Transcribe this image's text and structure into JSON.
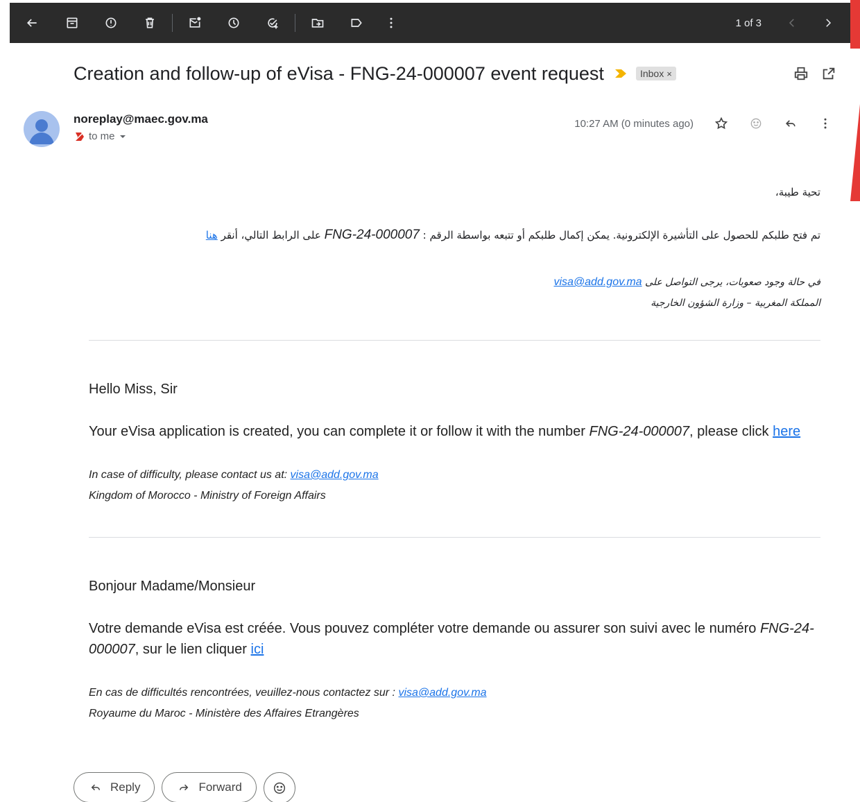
{
  "toolbar": {
    "icons": [
      "back-arrow-icon",
      "archive-icon",
      "report-spam-icon",
      "delete-icon",
      "mark-unread-icon",
      "snooze-icon",
      "add-task-icon",
      "move-to-icon",
      "label-icon",
      "more-vert-icon"
    ],
    "pager_text": "1 of 3"
  },
  "email": {
    "subject": "Creation and follow-up of eVisa - FNG-24-000007 event request",
    "label": "Inbox",
    "label_close": "×",
    "sender": "noreplay@maec.gov.ma",
    "to": "to me",
    "time": "10:27 AM (0 minutes ago)"
  },
  "arabic": {
    "greeting": "تحية طيبة،",
    "p1_before": "تم فتح طلبكم للحصول على التأشيرة الإلكترونية. يمكن إكمال طلبكم أو تتبعه بواسطة الرقم : ",
    "number": "FNG-24-000007",
    "p1_after": " على الرابط التالي، أنقر ",
    "link": "هنا",
    "contact_before": "في حالة وجود صعوبات، يرجى التواصل على ",
    "contact_email": "visa@add.gov.ma",
    "signature": "المملكة المغربية – وزارة الشؤون الخارجية"
  },
  "english": {
    "greeting": "Hello Miss, Sir",
    "p1_before": "Your eVisa application is created, you can complete it or follow it with the number ",
    "number": "FNG-24-000007",
    "p1_after": ", please click ",
    "link": "here",
    "contact_before": "In case of difficulty, please contact us at: ",
    "contact_email": "visa@add.gov.ma",
    "signature": "Kingdom of Morocco - Ministry of Foreign Affairs"
  },
  "french": {
    "greeting": "Bonjour Madame/Monsieur",
    "p1_before": "Votre demande eVisa est créée. Vous pouvez compléter votre demande ou assurer son suivi avec le numéro ",
    "number": "FNG-24-000007",
    "p1_after": ", sur le lien cliquer ",
    "link": "ici",
    "contact_before": "En cas de difficultés rencontrées, veuillez-nous contactez sur : ",
    "contact_email": "visa@add.gov.ma",
    "signature": "Royaume du Maroc - Ministère des Affaires Etrangères"
  },
  "actions": {
    "reply": "Reply",
    "forward": "Forward"
  },
  "colors": {
    "toolbar_bg": "#2b2b2b",
    "link": "#1a73e8",
    "importance": "#f4b400",
    "accent_edge": "#e53935"
  }
}
